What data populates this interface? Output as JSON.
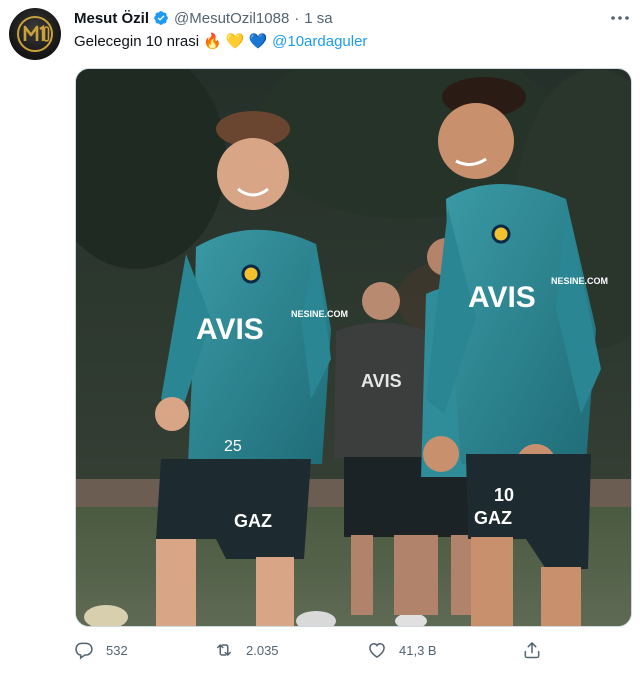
{
  "tweet": {
    "author_name": "Mesut Özil",
    "handle": "@MesutOzil1088",
    "separator": "·",
    "time": "1 sa",
    "text": "Gelecegin 10 nrasi",
    "emojis": [
      "🔥",
      "💛",
      "💙"
    ],
    "mention": "@10ardaguler",
    "more_icon": "more-horizontal-icon",
    "verified_icon": "verified-badge-icon",
    "colors": {
      "accent": "#1d9bf0",
      "muted": "#536471",
      "text": "#0f1419"
    }
  },
  "photo": {
    "jersey_sponsor": "AVIS",
    "jersey_sleeve": "NESINE.COM",
    "shorts_sponsor": "GAZ",
    "left_player_number": "25",
    "right_player_number": "10"
  },
  "actions": {
    "replies": "532",
    "retweets": "2.035",
    "likes": "41,3 B"
  }
}
